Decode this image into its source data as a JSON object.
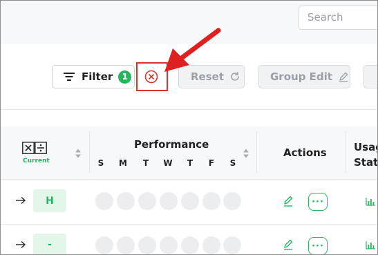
{
  "search": {
    "placeholder": "Search"
  },
  "toolbar": {
    "filter_label": "Filter",
    "filter_count": "1",
    "reset_label": "Reset",
    "group_edit_label": "Group Edit"
  },
  "table": {
    "current_label": "Current",
    "performance_label": "Performance",
    "days": [
      "S",
      "M",
      "T",
      "W",
      "T",
      "F",
      "S"
    ],
    "actions_label": "Actions",
    "usage_label_line1": "Usag",
    "usage_label_line2": "Stat",
    "rows": [
      {
        "status": "H",
        "more": "···"
      },
      {
        "status": "-",
        "more": "···"
      }
    ]
  },
  "colors": {
    "accent": "#27b45f",
    "annotation": "#d9342b",
    "disabled": "#9aa0a6"
  },
  "icons": [
    "filter-icon",
    "clear-filter-icon",
    "reset-icon",
    "pencil-icon",
    "calculator-icon",
    "sort-icon",
    "arrow-right-icon",
    "bar-chart-icon"
  ]
}
